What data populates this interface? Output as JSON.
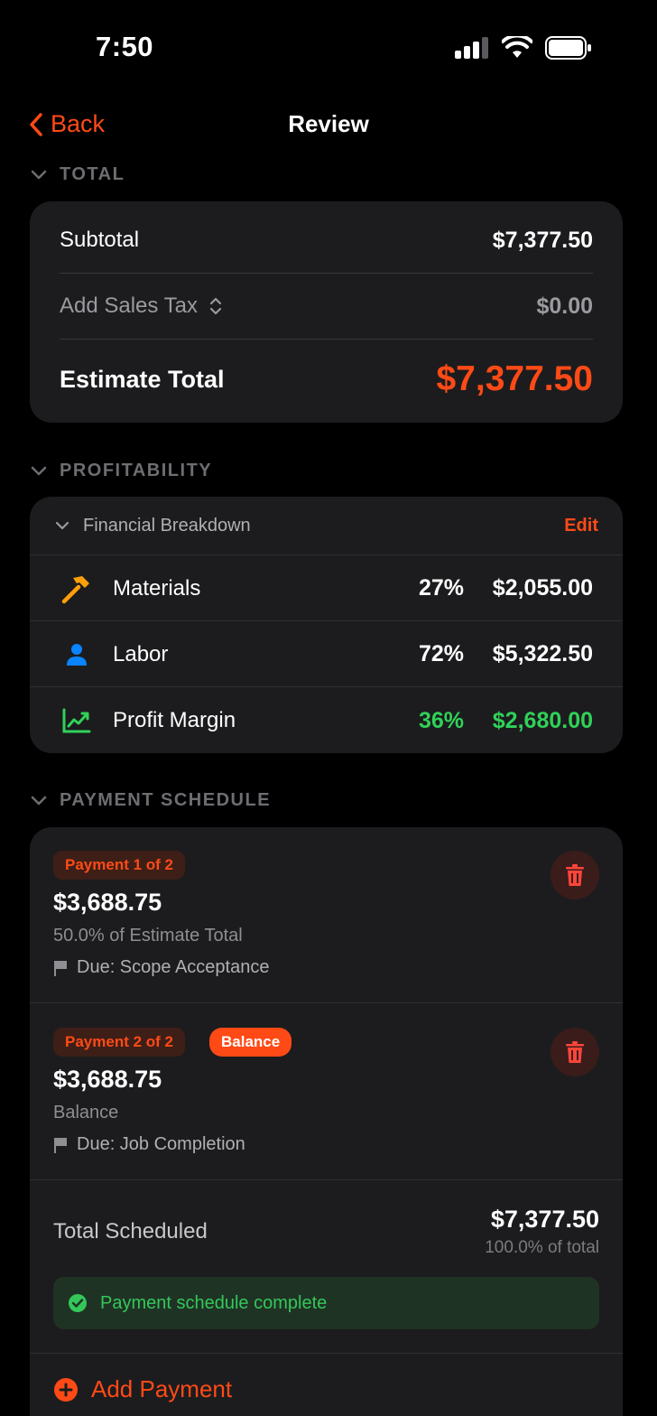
{
  "status_bar": {
    "time": "7:50"
  },
  "nav": {
    "back_label": "Back",
    "title": "Review"
  },
  "total_section": {
    "header": "TOTAL",
    "subtotal_label": "Subtotal",
    "subtotal_value": "$7,377.50",
    "sales_tax_label": "Add Sales Tax",
    "sales_tax_value": "$0.00",
    "estimate_total_label": "Estimate Total",
    "estimate_total_value": "$7,377.50"
  },
  "profitability_section": {
    "header": "PROFITABILITY",
    "breakdown_title": "Financial Breakdown",
    "edit_label": "Edit",
    "rows": [
      {
        "icon": "hammer-icon",
        "name": "Materials",
        "percent": "27%",
        "amount": "$2,055.00",
        "color": "#ff9f0a"
      },
      {
        "icon": "person-icon",
        "name": "Labor",
        "percent": "72%",
        "amount": "$5,322.50",
        "color": "#0a84ff"
      },
      {
        "icon": "chart-line-icon",
        "name": "Profit Margin",
        "percent": "36%",
        "amount": "$2,680.00",
        "color": "#30d158"
      }
    ]
  },
  "payment_section": {
    "header": "PAYMENT SCHEDULE",
    "payments": [
      {
        "badge": "Payment 1 of 2",
        "amount": "$3,688.75",
        "subtitle": "50.0% of Estimate Total",
        "due": "Due: Scope Acceptance"
      },
      {
        "badge": "Payment 2 of 2",
        "extra_badge": "Balance",
        "amount": "$3,688.75",
        "subtitle": "Balance",
        "due": "Due: Job Completion"
      }
    ],
    "total_scheduled_label": "Total Scheduled",
    "total_scheduled_value": "$7,377.50",
    "total_scheduled_percent": "100.0% of total",
    "complete_message": "Payment schedule complete",
    "add_payment_label": "Add Payment"
  },
  "colors": {
    "accent": "#ff4a16",
    "success": "#34c759",
    "card": "#1c1c1e"
  }
}
